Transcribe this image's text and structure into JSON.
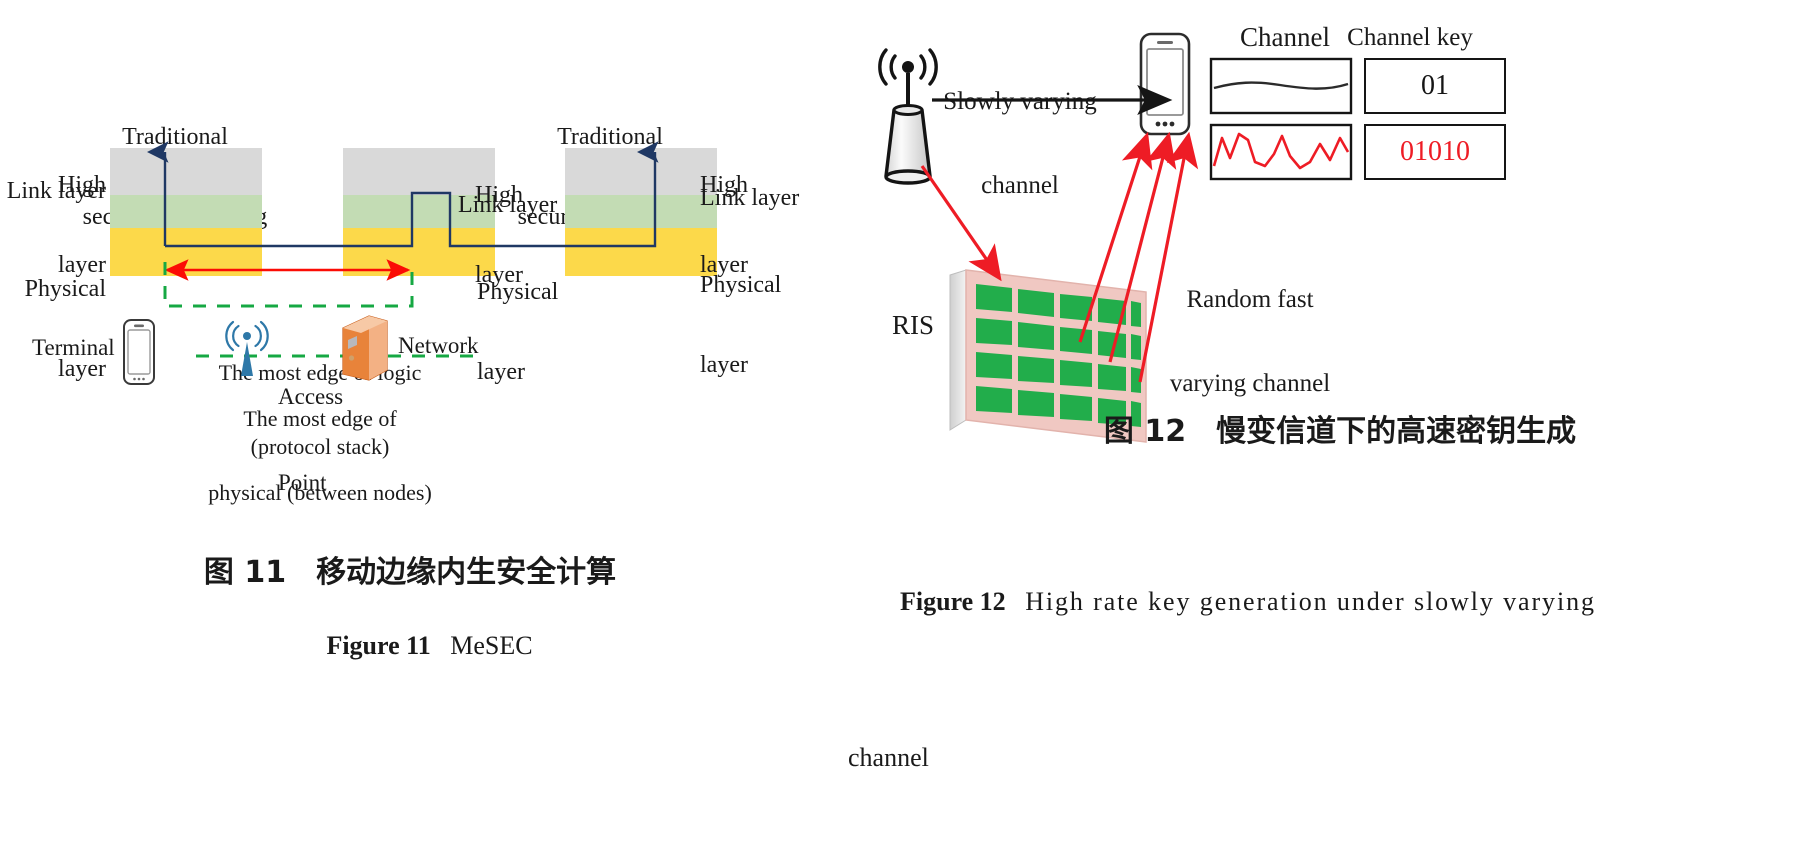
{
  "figure11": {
    "layer_labels_left": [
      "High",
      "layer",
      "Link layer",
      "Physical",
      "layer"
    ],
    "label_high_left_l1": "High",
    "label_high_left_l2": "layer",
    "label_link_left": "Link layer",
    "label_phys_left_l1": "Physical",
    "label_phys_left_l2": "layer",
    "label_high_mid_l1": "High",
    "label_high_mid_l2": "layer",
    "label_link_mid": "Link layer",
    "label_phys_mid_l1": "Physical",
    "label_phys_mid_l2": "layer",
    "label_high_right_l1": "High",
    "label_high_right_l2": "layer",
    "label_link_right": "Link layer",
    "label_phys_right_l1": "Physical",
    "label_phys_right_l2": "layer",
    "traditional_left_l1": "Traditional",
    "traditional_left_l2": "security computing",
    "traditional_right_l1": "Traditional",
    "traditional_right_l2": "security computing",
    "edge_logic_l1": "The most edge of logic",
    "edge_logic_l2": "(protocol stack)",
    "edge_physical_l1": "The most edge of",
    "edge_physical_l2": "physical (between nodes)",
    "terminal_label": "Terminal",
    "access_point_l1": "Access",
    "access_point_l2": "Point",
    "network_label": "Network",
    "caption_cn": "图 11　移动边缘内生安全计算",
    "caption_en_prefix": "Figure 11",
    "caption_en_text": "MeSEC",
    "colors": {
      "high_layer": "#d9d9d9",
      "link_layer": "#c3dcb4",
      "physical_layer": "#fcd94a",
      "arrow_navy": "#1f3864",
      "arrow_red": "#fb0c05",
      "dashed_green": "#16a843",
      "ap_blue": "#2e78a8",
      "network_orange": "#e8833a"
    }
  },
  "figure12": {
    "slowly_varying_l1": "Slowly varying",
    "slowly_varying_l2": "channel",
    "random_fast_l1": "Random fast",
    "random_fast_l2": "varying channel",
    "ris_label": "RIS",
    "header_channel": "Channel",
    "header_channel_key": "Channel key",
    "key_slow": "01",
    "key_fast": "01010",
    "caption_cn": "图 12　慢变信道下的高速密钥生成",
    "caption_en_prefix": "Figure 12",
    "caption_en_text": "High rate key generation under slowly varying",
    "caption_en_text2": "channel",
    "colors": {
      "red": "#ee1c25",
      "black": "#151515",
      "ris_frame": "#f0c8c2",
      "ris_tile": "#22ad4b"
    }
  }
}
